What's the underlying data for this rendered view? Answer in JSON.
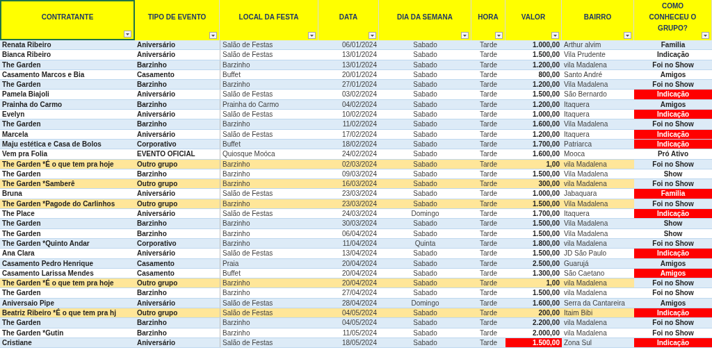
{
  "columns": [
    {
      "label": "CONTRATANTE",
      "selected": true
    },
    {
      "label": "TIPO DE EVENTO",
      "selected": false
    },
    {
      "label": "LOCAL DA FESTA",
      "selected": false
    },
    {
      "label": "DATA",
      "selected": false
    },
    {
      "label": "DIA DA SEMANA",
      "selected": false
    },
    {
      "label": "HORA",
      "selected": false
    },
    {
      "label": "VALOR",
      "selected": false
    },
    {
      "label": "BAIRRO",
      "selected": false
    },
    {
      "label": "COMO CONHECEU O GRUPO?",
      "selected": false
    }
  ],
  "rows": [
    {
      "highlighted": false,
      "contratante": "Renata  Ribeiro",
      "tipo": "Aniversário",
      "local": "Salão de Festas",
      "data": "06/01/2024",
      "dia": "Sabado",
      "hora": "Tarde",
      "valor": "1.000,00",
      "valor_alert": false,
      "bairro": "Arthur alvim",
      "origem": "Familia",
      "origem_alert": false
    },
    {
      "highlighted": false,
      "contratante": "Bianca Ribeiro",
      "tipo": "Aniversário",
      "local": "Salão de Festas",
      "data": "13/01/2024",
      "dia": "Sabado",
      "hora": "Tarde",
      "valor": "1.500,00",
      "valor_alert": false,
      "bairro": "Vila Prudente",
      "origem": "Indicação",
      "origem_alert": false
    },
    {
      "highlighted": false,
      "contratante": "The Garden",
      "tipo": "Barzinho",
      "local": "Barzinho",
      "data": "13/01/2024",
      "dia": "Sabado",
      "hora": "Tarde",
      "valor": "1.200,00",
      "valor_alert": false,
      "bairro": "vila Madalena",
      "origem": "Foi no Show",
      "origem_alert": false
    },
    {
      "highlighted": false,
      "contratante": "Casamento Marcos e Bia",
      "tipo": "Casamento",
      "local": "Buffet",
      "data": "20/01/2024",
      "dia": "Sabado",
      "hora": "Tarde",
      "valor": "800,00",
      "valor_alert": false,
      "bairro": "Santo André",
      "origem": "Amigos",
      "origem_alert": false
    },
    {
      "highlighted": false,
      "contratante": "The Garden",
      "tipo": "Barzinho",
      "local": "Barzinho",
      "data": "27/01/2024",
      "dia": "Sabado",
      "hora": "Tarde",
      "valor": "1.200,00",
      "valor_alert": false,
      "bairro": "Vila Madalena",
      "origem": "Foi no Show",
      "origem_alert": false
    },
    {
      "highlighted": false,
      "contratante": "Pamela Biajoli",
      "tipo": "Aniversário",
      "local": "Salão de Festas",
      "data": "03/02/2024",
      "dia": "Sabado",
      "hora": "Tarde",
      "valor": "1.500,00",
      "valor_alert": false,
      "bairro": "São Bernardo",
      "origem": "Indicação",
      "origem_alert": true
    },
    {
      "highlighted": false,
      "contratante": "Prainha do Carmo",
      "tipo": "Barzinho",
      "local": "Prainha do Carmo",
      "data": "04/02/2024",
      "dia": "Sabado",
      "hora": "Tarde",
      "valor": "1.200,00",
      "valor_alert": false,
      "bairro": "Itaquera",
      "origem": "Amigos",
      "origem_alert": false
    },
    {
      "highlighted": false,
      "contratante": "Evelyn",
      "tipo": "Aniversário",
      "local": "Salão de Festas",
      "data": "10/02/2024",
      "dia": "Sabado",
      "hora": "Tarde",
      "valor": "1.000,00",
      "valor_alert": false,
      "bairro": "Itaquera",
      "origem": "Indicação",
      "origem_alert": true
    },
    {
      "highlighted": false,
      "contratante": "The Garden",
      "tipo": "Barzinho",
      "local": "Barzinho",
      "data": "11/02/2024",
      "dia": "Sabado",
      "hora": "Tarde",
      "valor": "1.600,00",
      "valor_alert": false,
      "bairro": "Vila Madalena",
      "origem": "Foi no Show",
      "origem_alert": false
    },
    {
      "highlighted": false,
      "contratante": "Marcela",
      "tipo": "Aniversário",
      "local": "Salão de Festas",
      "data": "17/02/2024",
      "dia": "Sabado",
      "hora": "Tarde",
      "valor": "1.200,00",
      "valor_alert": false,
      "bairro": "Itaquera",
      "origem": "Indicação",
      "origem_alert": true
    },
    {
      "highlighted": false,
      "contratante": "Maju estética e Casa de Bolos",
      "tipo": "Corporativo",
      "local": "Buffet",
      "data": "18/02/2024",
      "dia": "Sabado",
      "hora": "Tarde",
      "valor": "1.700,00",
      "valor_alert": false,
      "bairro": "Patriarca",
      "origem": "Indicação",
      "origem_alert": true
    },
    {
      "highlighted": false,
      "contratante": "Vem pra Folia",
      "tipo": "EVENTO OFICIAL",
      "local": "Quiosque Moóca",
      "data": "24/02/2024",
      "dia": "Sabado",
      "hora": "Tarde",
      "valor": "1.600,00",
      "valor_alert": false,
      "bairro": "Mooca",
      "origem": "Pró Ativo",
      "origem_alert": false
    },
    {
      "highlighted": true,
      "contratante": "The Garden *É o que tem pra hoje",
      "tipo": "Outro grupo",
      "local": "Barzinho",
      "data": "02/03/2024",
      "dia": "Sabado",
      "hora": "Tarde",
      "valor": "1,00",
      "valor_alert": false,
      "bairro": "vila Madalena",
      "origem": "Foi no Show",
      "origem_alert": false
    },
    {
      "highlighted": false,
      "contratante": "The Garden",
      "tipo": "Barzinho",
      "local": "Barzinho",
      "data": "09/03/2024",
      "dia": "Sabado",
      "hora": "Tarde",
      "valor": "1.500,00",
      "valor_alert": false,
      "bairro": "Vila Madalena",
      "origem": "Show",
      "origem_alert": false
    },
    {
      "highlighted": true,
      "contratante": "The Garden *Samberê",
      "tipo": "Outro grupo",
      "local": "Barzinho",
      "data": "16/03/2024",
      "dia": "Sabado",
      "hora": "Tarde",
      "valor": "300,00",
      "valor_alert": false,
      "bairro": "vila Madalena",
      "origem": "Foi no Show",
      "origem_alert": false
    },
    {
      "highlighted": false,
      "contratante": "Bruna",
      "tipo": "Aniversário",
      "local": "Salão de Festas",
      "data": "23/03/2024",
      "dia": "Sabado",
      "hora": "Tarde",
      "valor": "1.000,00",
      "valor_alert": false,
      "bairro": "Jabaquara",
      "origem": "Familia",
      "origem_alert": true
    },
    {
      "highlighted": true,
      "contratante": "The Garden *Pagode do Carlinhos",
      "tipo": "Outro grupo",
      "local": "Barzinho",
      "data": "23/03/2024",
      "dia": "Sabado",
      "hora": "Tarde",
      "valor": "1.500,00",
      "valor_alert": false,
      "bairro": "Vila Madalena",
      "origem": "Foi no Show",
      "origem_alert": false
    },
    {
      "highlighted": false,
      "contratante": "The Place",
      "tipo": "Aniversário",
      "local": "Salão de Festas",
      "data": "24/03/2024",
      "dia": "Domingo",
      "hora": "Tarde",
      "valor": "1.700,00",
      "valor_alert": false,
      "bairro": "Itaquera",
      "origem": "Indicação",
      "origem_alert": true
    },
    {
      "highlighted": false,
      "contratante": "The Garden",
      "tipo": "Barzinho",
      "local": "Barzinho",
      "data": "30/03/2024",
      "dia": "Sabado",
      "hora": "Tarde",
      "valor": "1.500,00",
      "valor_alert": false,
      "bairro": "Vila Madalena",
      "origem": "Show",
      "origem_alert": false
    },
    {
      "highlighted": false,
      "contratante": "The Garden",
      "tipo": "Barzinho",
      "local": "Barzinho",
      "data": "06/04/2024",
      "dia": "Sabado",
      "hora": "Tarde",
      "valor": "1.500,00",
      "valor_alert": false,
      "bairro": "Vila Madalena",
      "origem": "Show",
      "origem_alert": false
    },
    {
      "highlighted": false,
      "contratante": "The Garden *Quinto Andar",
      "tipo": "Corporativo",
      "local": "Barzinho",
      "data": "11/04/2024",
      "dia": "Quinta",
      "hora": "Tarde",
      "valor": "1.800,00",
      "valor_alert": false,
      "bairro": "vila Madalena",
      "origem": "Foi no Show",
      "origem_alert": false
    },
    {
      "highlighted": false,
      "contratante": "Ana Clara",
      "tipo": "Aniversário",
      "local": "Salão de Festas",
      "data": "13/04/2024",
      "dia": "Sabado",
      "hora": "Tarde",
      "valor": "1.500,00",
      "valor_alert": false,
      "bairro": "JD São Paulo",
      "origem": "Indicação",
      "origem_alert": true
    },
    {
      "highlighted": false,
      "contratante": "Casamento Pedro Henrique",
      "tipo": "Casamento",
      "local": "Praia",
      "data": "20/04/2024",
      "dia": "Sabado",
      "hora": "Tarde",
      "valor": "2.500,00",
      "valor_alert": false,
      "bairro": "Guarujá",
      "origem": "Amigos",
      "origem_alert": false
    },
    {
      "highlighted": false,
      "contratante": "Casamento Larissa Mendes",
      "tipo": "Casamento",
      "local": "Buffet",
      "data": "20/04/2024",
      "dia": "Sabado",
      "hora": "Tarde",
      "valor": "1.300,00",
      "valor_alert": false,
      "bairro": "São Caetano",
      "origem": "Amigos",
      "origem_alert": true
    },
    {
      "highlighted": true,
      "contratante": "The Garden *É o que tem pra hoje",
      "tipo": "Outro grupo",
      "local": "Barzinho",
      "data": "20/04/2024",
      "dia": "Sabado",
      "hora": "Tarde",
      "valor": "1,00",
      "valor_alert": false,
      "bairro": "vila Madalena",
      "origem": "Foi no Show",
      "origem_alert": false
    },
    {
      "highlighted": false,
      "contratante": "The Garden",
      "tipo": "Barzinho",
      "local": "Barzinho",
      "data": "27/04/2024",
      "dia": "Sabado",
      "hora": "Tarde",
      "valor": "1.500,00",
      "valor_alert": false,
      "bairro": "vila Madalena",
      "origem": "Foi no Show",
      "origem_alert": false
    },
    {
      "highlighted": false,
      "contratante": "Aniversaio Pipe",
      "tipo": "Aniversário",
      "local": "Salão de Festas",
      "data": "28/04/2024",
      "dia": "Domingo",
      "hora": "Tarde",
      "valor": "1.600,00",
      "valor_alert": false,
      "bairro": "Serra da Cantareira",
      "origem": "Amigos",
      "origem_alert": false
    },
    {
      "highlighted": true,
      "contratante": "Beatriz Ribeiro *É o que tem pra hj",
      "tipo": "Outro grupo",
      "local": "Salão de Festas",
      "data": "04/05/2024",
      "dia": "Sabado",
      "hora": "Tarde",
      "valor": "200,00",
      "valor_alert": false,
      "bairro": "Itaim Bibi",
      "origem": "Indicação",
      "origem_alert": true
    },
    {
      "highlighted": false,
      "contratante": "The Garden",
      "tipo": "Barzinho",
      "local": "Barzinho",
      "data": "04/05/2024",
      "dia": "Sabado",
      "hora": "Tarde",
      "valor": "2.200,00",
      "valor_alert": false,
      "bairro": "vila Madalena",
      "origem": "Foi no Show",
      "origem_alert": false
    },
    {
      "highlighted": false,
      "contratante": "The Garden *Gutin",
      "tipo": "Barzinho",
      "local": "Barzinho",
      "data": "11/05/2024",
      "dia": "Sabado",
      "hora": "Tarde",
      "valor": "2.000,00",
      "valor_alert": false,
      "bairro": "vila Madalena",
      "origem": "Foi no Show",
      "origem_alert": false
    },
    {
      "highlighted": false,
      "contratante": "Cristiane",
      "tipo": "Aniversário",
      "local": "Salão de Festas",
      "data": "18/05/2024",
      "dia": "Sabado",
      "hora": "Tarde",
      "valor": "1.500,00",
      "valor_alert": true,
      "bairro": "Zona Sul",
      "origem": "Indicação",
      "origem_alert": true
    }
  ]
}
